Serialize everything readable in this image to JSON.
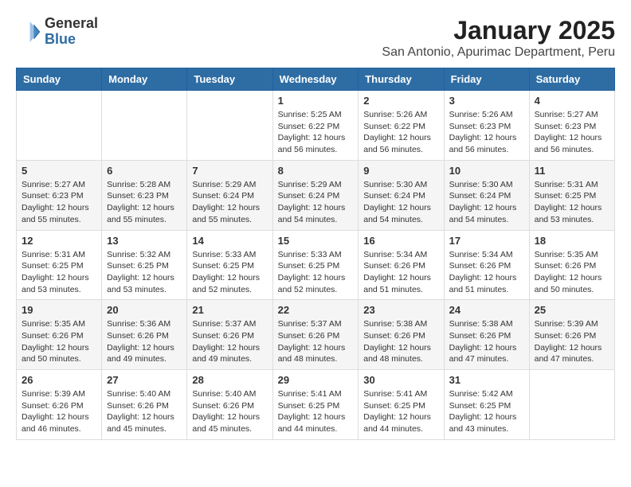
{
  "logo": {
    "general": "General",
    "blue": "Blue"
  },
  "title": "January 2025",
  "subtitle": "San Antonio, Apurimac Department, Peru",
  "weekdays": [
    "Sunday",
    "Monday",
    "Tuesday",
    "Wednesday",
    "Thursday",
    "Friday",
    "Saturday"
  ],
  "weeks": [
    [
      {
        "day": "",
        "sunrise": "",
        "sunset": "",
        "daylight": ""
      },
      {
        "day": "",
        "sunrise": "",
        "sunset": "",
        "daylight": ""
      },
      {
        "day": "",
        "sunrise": "",
        "sunset": "",
        "daylight": ""
      },
      {
        "day": "1",
        "sunrise": "Sunrise: 5:25 AM",
        "sunset": "Sunset: 6:22 PM",
        "daylight": "Daylight: 12 hours and 56 minutes."
      },
      {
        "day": "2",
        "sunrise": "Sunrise: 5:26 AM",
        "sunset": "Sunset: 6:22 PM",
        "daylight": "Daylight: 12 hours and 56 minutes."
      },
      {
        "day": "3",
        "sunrise": "Sunrise: 5:26 AM",
        "sunset": "Sunset: 6:23 PM",
        "daylight": "Daylight: 12 hours and 56 minutes."
      },
      {
        "day": "4",
        "sunrise": "Sunrise: 5:27 AM",
        "sunset": "Sunset: 6:23 PM",
        "daylight": "Daylight: 12 hours and 56 minutes."
      }
    ],
    [
      {
        "day": "5",
        "sunrise": "Sunrise: 5:27 AM",
        "sunset": "Sunset: 6:23 PM",
        "daylight": "Daylight: 12 hours and 55 minutes."
      },
      {
        "day": "6",
        "sunrise": "Sunrise: 5:28 AM",
        "sunset": "Sunset: 6:23 PM",
        "daylight": "Daylight: 12 hours and 55 minutes."
      },
      {
        "day": "7",
        "sunrise": "Sunrise: 5:29 AM",
        "sunset": "Sunset: 6:24 PM",
        "daylight": "Daylight: 12 hours and 55 minutes."
      },
      {
        "day": "8",
        "sunrise": "Sunrise: 5:29 AM",
        "sunset": "Sunset: 6:24 PM",
        "daylight": "Daylight: 12 hours and 54 minutes."
      },
      {
        "day": "9",
        "sunrise": "Sunrise: 5:30 AM",
        "sunset": "Sunset: 6:24 PM",
        "daylight": "Daylight: 12 hours and 54 minutes."
      },
      {
        "day": "10",
        "sunrise": "Sunrise: 5:30 AM",
        "sunset": "Sunset: 6:24 PM",
        "daylight": "Daylight: 12 hours and 54 minutes."
      },
      {
        "day": "11",
        "sunrise": "Sunrise: 5:31 AM",
        "sunset": "Sunset: 6:25 PM",
        "daylight": "Daylight: 12 hours and 53 minutes."
      }
    ],
    [
      {
        "day": "12",
        "sunrise": "Sunrise: 5:31 AM",
        "sunset": "Sunset: 6:25 PM",
        "daylight": "Daylight: 12 hours and 53 minutes."
      },
      {
        "day": "13",
        "sunrise": "Sunrise: 5:32 AM",
        "sunset": "Sunset: 6:25 PM",
        "daylight": "Daylight: 12 hours and 53 minutes."
      },
      {
        "day": "14",
        "sunrise": "Sunrise: 5:33 AM",
        "sunset": "Sunset: 6:25 PM",
        "daylight": "Daylight: 12 hours and 52 minutes."
      },
      {
        "day": "15",
        "sunrise": "Sunrise: 5:33 AM",
        "sunset": "Sunset: 6:25 PM",
        "daylight": "Daylight: 12 hours and 52 minutes."
      },
      {
        "day": "16",
        "sunrise": "Sunrise: 5:34 AM",
        "sunset": "Sunset: 6:26 PM",
        "daylight": "Daylight: 12 hours and 51 minutes."
      },
      {
        "day": "17",
        "sunrise": "Sunrise: 5:34 AM",
        "sunset": "Sunset: 6:26 PM",
        "daylight": "Daylight: 12 hours and 51 minutes."
      },
      {
        "day": "18",
        "sunrise": "Sunrise: 5:35 AM",
        "sunset": "Sunset: 6:26 PM",
        "daylight": "Daylight: 12 hours and 50 minutes."
      }
    ],
    [
      {
        "day": "19",
        "sunrise": "Sunrise: 5:35 AM",
        "sunset": "Sunset: 6:26 PM",
        "daylight": "Daylight: 12 hours and 50 minutes."
      },
      {
        "day": "20",
        "sunrise": "Sunrise: 5:36 AM",
        "sunset": "Sunset: 6:26 PM",
        "daylight": "Daylight: 12 hours and 49 minutes."
      },
      {
        "day": "21",
        "sunrise": "Sunrise: 5:37 AM",
        "sunset": "Sunset: 6:26 PM",
        "daylight": "Daylight: 12 hours and 49 minutes."
      },
      {
        "day": "22",
        "sunrise": "Sunrise: 5:37 AM",
        "sunset": "Sunset: 6:26 PM",
        "daylight": "Daylight: 12 hours and 48 minutes."
      },
      {
        "day": "23",
        "sunrise": "Sunrise: 5:38 AM",
        "sunset": "Sunset: 6:26 PM",
        "daylight": "Daylight: 12 hours and 48 minutes."
      },
      {
        "day": "24",
        "sunrise": "Sunrise: 5:38 AM",
        "sunset": "Sunset: 6:26 PM",
        "daylight": "Daylight: 12 hours and 47 minutes."
      },
      {
        "day": "25",
        "sunrise": "Sunrise: 5:39 AM",
        "sunset": "Sunset: 6:26 PM",
        "daylight": "Daylight: 12 hours and 47 minutes."
      }
    ],
    [
      {
        "day": "26",
        "sunrise": "Sunrise: 5:39 AM",
        "sunset": "Sunset: 6:26 PM",
        "daylight": "Daylight: 12 hours and 46 minutes."
      },
      {
        "day": "27",
        "sunrise": "Sunrise: 5:40 AM",
        "sunset": "Sunset: 6:26 PM",
        "daylight": "Daylight: 12 hours and 45 minutes."
      },
      {
        "day": "28",
        "sunrise": "Sunrise: 5:40 AM",
        "sunset": "Sunset: 6:26 PM",
        "daylight": "Daylight: 12 hours and 45 minutes."
      },
      {
        "day": "29",
        "sunrise": "Sunrise: 5:41 AM",
        "sunset": "Sunset: 6:25 PM",
        "daylight": "Daylight: 12 hours and 44 minutes."
      },
      {
        "day": "30",
        "sunrise": "Sunrise: 5:41 AM",
        "sunset": "Sunset: 6:25 PM",
        "daylight": "Daylight: 12 hours and 44 minutes."
      },
      {
        "day": "31",
        "sunrise": "Sunrise: 5:42 AM",
        "sunset": "Sunset: 6:25 PM",
        "daylight": "Daylight: 12 hours and 43 minutes."
      },
      {
        "day": "",
        "sunrise": "",
        "sunset": "",
        "daylight": ""
      }
    ]
  ]
}
